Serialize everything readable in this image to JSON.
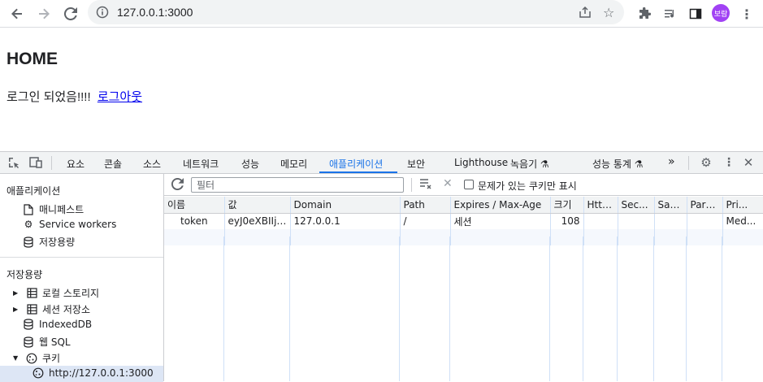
{
  "browser": {
    "url": "127.0.0.1:3000",
    "profile_label": "보람",
    "icons": [
      "back-arrow-icon",
      "forward-arrow-icon",
      "reload-icon",
      "info-icon",
      "share-icon",
      "star-icon",
      "extensions-icon",
      "media-icon",
      "side-panel-icon",
      "more-vert-icon"
    ]
  },
  "page": {
    "heading": "HOME",
    "message": "로그인 되었음!!!!",
    "logout_link": "로그아웃"
  },
  "devtools": {
    "tabs": [
      "요소",
      "콘솔",
      "소스",
      "네트워크",
      "성능",
      "메모리",
      "애플리케이션",
      "보안",
      "Lighthouse",
      "녹음기 ⚗",
      "성능 통계 ⚗"
    ],
    "active_tab": "애플리케이션",
    "more_tabs": "»",
    "sidebar": {
      "app_header": "애플리케이션",
      "app_items": [
        "매니페스트",
        "Service workers",
        "저장용량"
      ],
      "storage_header": "저장용량",
      "storage_items": [
        "로컬 스토리지",
        "세션 저장소",
        "IndexedDB",
        "웹 SQL",
        "쿠키"
      ],
      "cookie_origin": "http://127.0.0.1:3000"
    },
    "filter": {
      "placeholder": "필터",
      "issues_checkbox_label": "문제가 있는 쿠키만 표시",
      "issues_checkbox_checked": false
    },
    "cookie_table": {
      "columns": [
        "이름",
        "값",
        "Domain",
        "Path",
        "Expires / Max-Age",
        "크기",
        "Http...",
        "Sec...",
        "Sam...",
        "Parti...",
        "Pri..."
      ],
      "rows": [
        [
          "token",
          "eyJ0eXBIIjoi...",
          "127.0.0.1",
          "/",
          "세션",
          "108",
          "",
          "",
          "",
          "",
          "Med..."
        ]
      ]
    }
  }
}
